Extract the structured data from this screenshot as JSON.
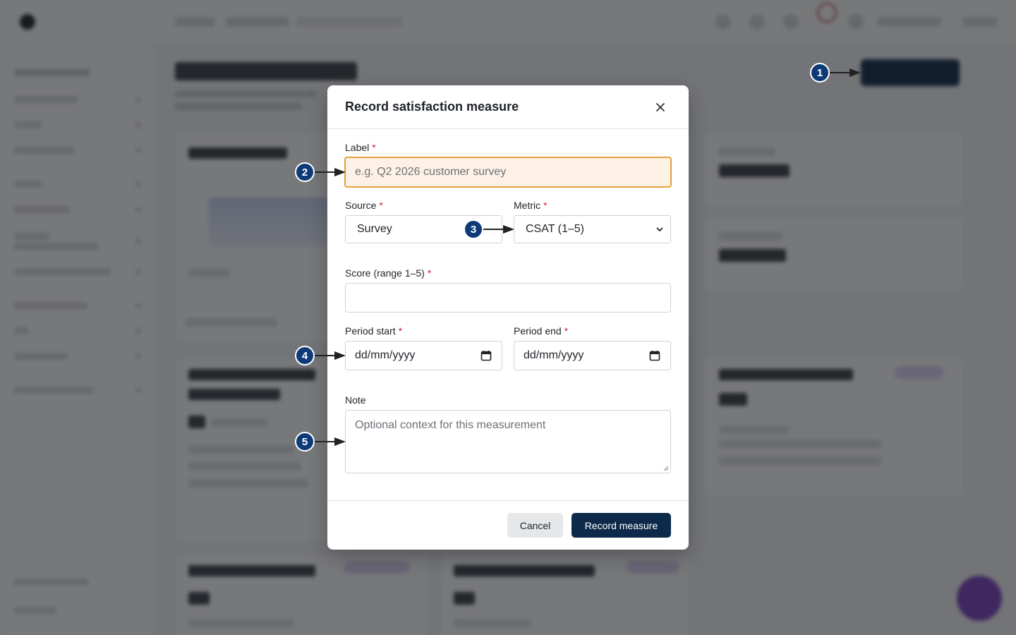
{
  "modal": {
    "title": "Record satisfaction measure",
    "label_field": {
      "label": "Label",
      "required": "*",
      "placeholder": "e.g. Q2 2026 customer survey"
    },
    "source_field": {
      "label": "Source",
      "required": "*",
      "value": "Survey"
    },
    "metric_field": {
      "label": "Metric",
      "required": "*",
      "value": "CSAT (1–5)"
    },
    "score_field": {
      "label": "Score (range 1–5)",
      "required": "*",
      "value": ""
    },
    "period_start": {
      "label": "Period start",
      "required": "*",
      "value": "dd/mm/yyyy"
    },
    "period_end": {
      "label": "Period end",
      "required": "*",
      "value": "dd/mm/yyyy"
    },
    "note_field": {
      "label": "Note",
      "placeholder": "Optional context for this measurement"
    },
    "cancel_label": "Cancel",
    "submit_label": "Record measure"
  },
  "callouts": [
    "1",
    "2",
    "3",
    "4",
    "5"
  ],
  "colors": {
    "primary": "#0e2a4a",
    "focus_border": "#e8a13a",
    "focus_bg": "#fdf1e6",
    "required": "#d1242f",
    "callout": "#0e3a78"
  },
  "icons": {
    "close": "close-icon",
    "calendar": "calendar-icon",
    "caret": "chevron-down-icon"
  }
}
